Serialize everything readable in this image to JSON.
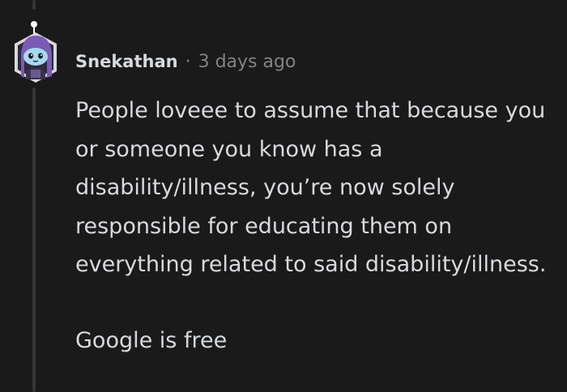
{
  "comment": {
    "author": "Snekathan",
    "separator": "·",
    "time_ago": "3 days ago",
    "paragraphs": [
      "People loveee to assume that because you or someone you know has a disability/illness, you’re now solely responsible for educating them on everything related to said disability/illness.",
      "Google is free"
    ]
  },
  "colors": {
    "background": "#1a1a1b",
    "text": "#d7dadc",
    "meta": "#818384",
    "thread_line": "#343536",
    "avatar_purple": "#7b5bb5",
    "avatar_face": "#a8d8f0"
  },
  "icons": {
    "avatar": "snoo-avatar-icon"
  }
}
